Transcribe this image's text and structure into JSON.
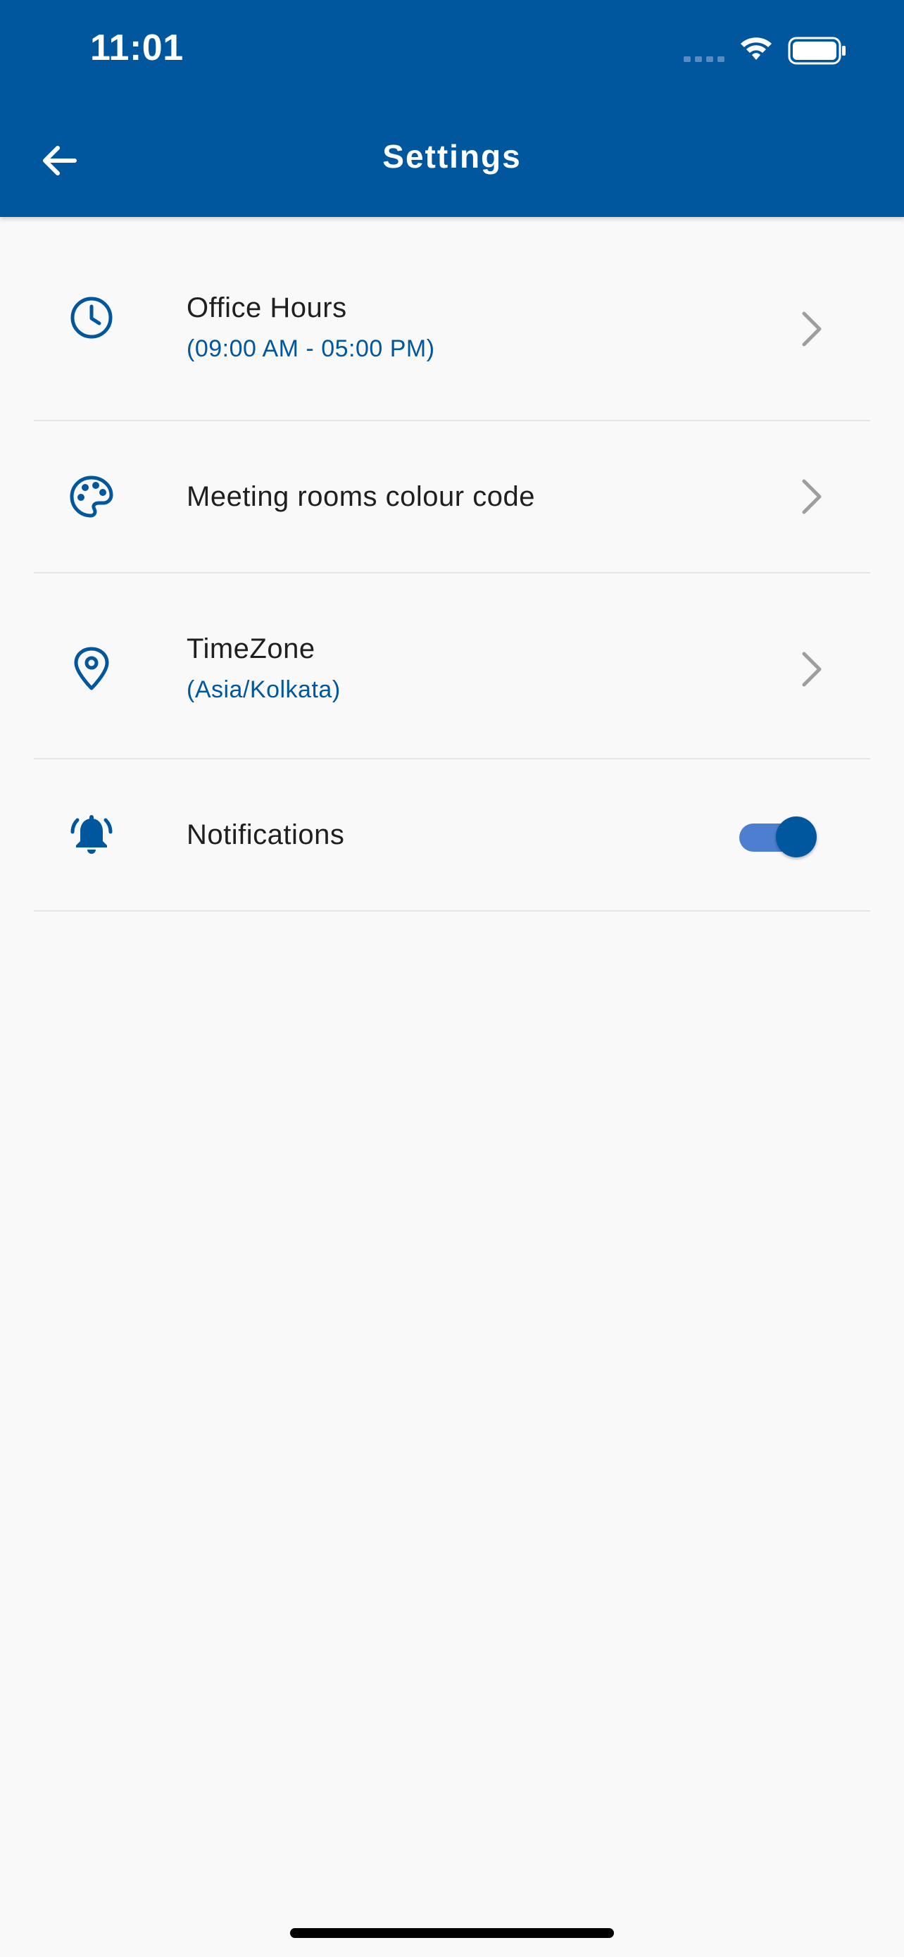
{
  "status_bar": {
    "time": "11:01"
  },
  "app_bar": {
    "title": "Settings",
    "back_icon": "arrow-left-icon",
    "background_color": "#01579e"
  },
  "settings": {
    "items": [
      {
        "title": "Office Hours",
        "subtitle": "(09:00 AM - 05:00 PM)",
        "icon": "clock-icon",
        "trailing": "chevron-right-icon"
      },
      {
        "title": "Meeting rooms colour code",
        "icon": "palette-icon",
        "trailing": "chevron-right-icon"
      },
      {
        "title": "TimeZone",
        "subtitle": "(Asia/Kolkata)",
        "icon": "location-pin-icon",
        "trailing": "chevron-right-icon"
      },
      {
        "title": "Notifications",
        "icon": "bell-ringing-icon",
        "toggle_on": true
      }
    ]
  },
  "colors": {
    "accent": "#01579e",
    "toggle_track": "#4d7fd0",
    "background": "#f9f9f9",
    "chevron": "#9e9e9e"
  }
}
